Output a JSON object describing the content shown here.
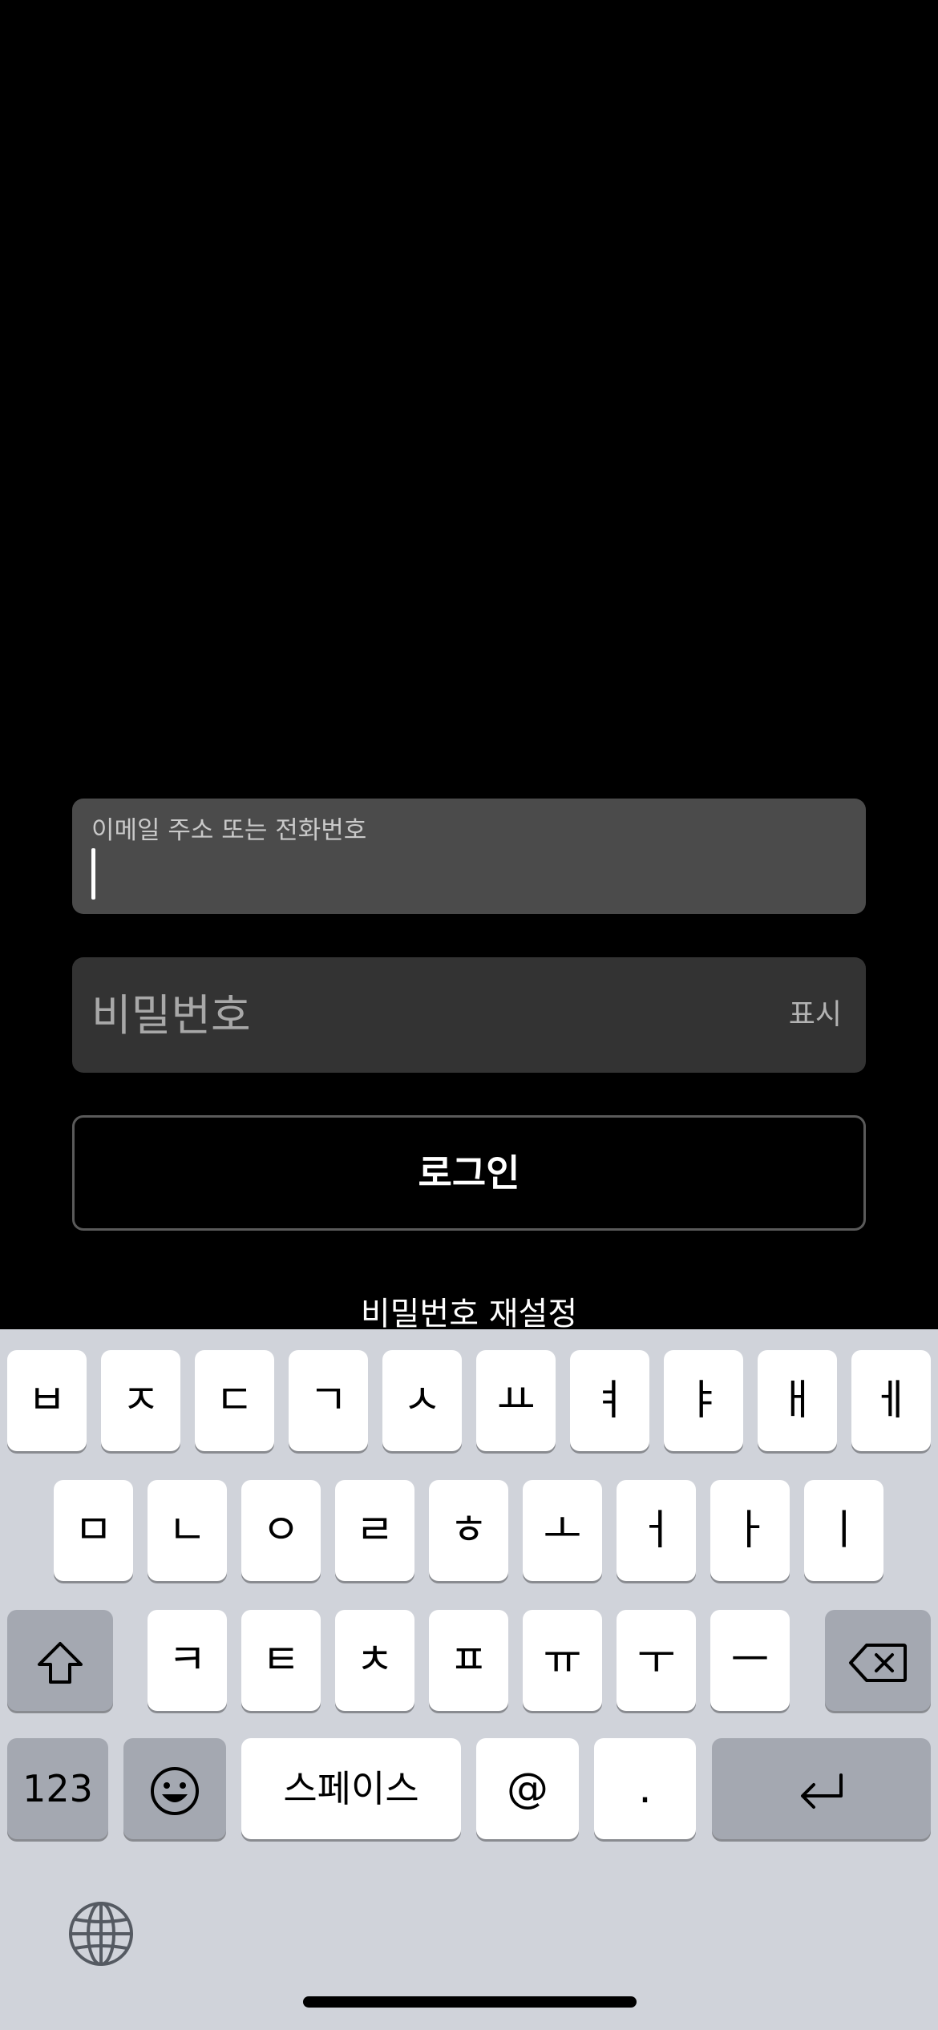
{
  "form": {
    "email_label": "이메일 주소 또는 전화번호",
    "email_value": "",
    "password_placeholder": "비밀번호",
    "password_value": "",
    "show_label": "표시",
    "login_label": "로그인",
    "reset_label": "비밀번호 재설정"
  },
  "keyboard": {
    "row1": [
      "ㅂ",
      "ㅈ",
      "ㄷ",
      "ㄱ",
      "ㅅ",
      "ㅛ",
      "ㅕ",
      "ㅑ",
      "ㅐ",
      "ㅔ"
    ],
    "row2": [
      "ㅁ",
      "ㄴ",
      "ㅇ",
      "ㄹ",
      "ㅎ",
      "ㅗ",
      "ㅓ",
      "ㅏ",
      "ㅣ"
    ],
    "row3": [
      "ㅋ",
      "ㅌ",
      "ㅊ",
      "ㅍ",
      "ㅠ",
      "ㅜ",
      "ㅡ"
    ],
    "numbers_label": "123",
    "space_label": "스페이스",
    "at_label": "@",
    "period_label": ".",
    "icons": {
      "shift": "shift-icon",
      "delete": "backspace-icon",
      "emoji": "emoji-icon",
      "return": "return-icon",
      "globe": "globe-icon"
    }
  },
  "colors": {
    "background": "#000000",
    "email_field": "#4b4b4b",
    "password_field": "#333333",
    "keyboard_bg": "#d0d3da",
    "key_light": "#ffffff",
    "key_dark": "#a4a8b1"
  }
}
